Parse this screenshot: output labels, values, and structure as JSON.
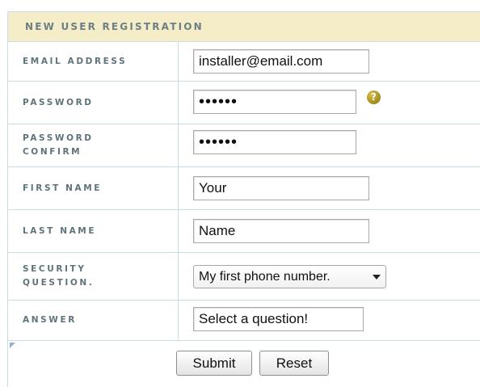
{
  "form": {
    "title": "NEW USER REGISTRATION",
    "fields": [
      {
        "label": "EMAIL ADDRESS",
        "value": "installer@email.com"
      },
      {
        "label": "PASSWORD",
        "value": "••••••",
        "help_icon": "question-mark-icon"
      },
      {
        "label_line1": "PASSWORD",
        "label_line2": "CONFIRM",
        "value": "••••••"
      },
      {
        "label": "FIRST NAME",
        "value": "Your"
      },
      {
        "label": "LAST NAME",
        "value": "Name"
      },
      {
        "label_line1": "SECURITY",
        "label_line2": "QUESTION.",
        "selected": "My first phone number."
      },
      {
        "label": "ANSWER",
        "value": "Select a question!"
      }
    ],
    "buttons": {
      "submit": "Submit",
      "reset": "Reset"
    }
  },
  "colors": {
    "header_bg": "#f5edc7",
    "label_text": "#5f737b",
    "border": "#c9dbe3",
    "help_icon": "#a08a18"
  },
  "icons": {
    "help": "question-mark-icon",
    "dropdown": "chevron-down-icon",
    "corner": "corner-triangle-icon"
  }
}
